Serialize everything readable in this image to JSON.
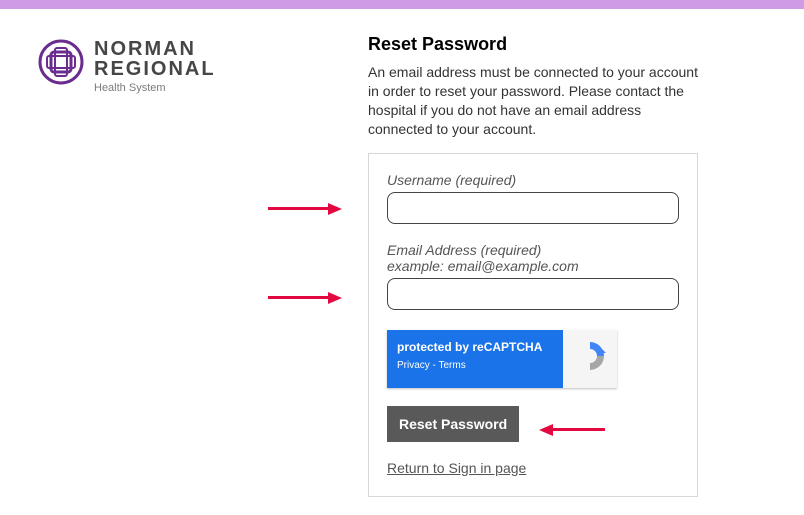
{
  "brand": {
    "name_line1": "NORMAN",
    "name_line2": "REGIONAL",
    "sub": "Health System"
  },
  "heading": "Reset Password",
  "description": "An email address must be connected to your account in order to reset your password. Please contact the hospital if you do not have an email address connected to your account.",
  "fields": {
    "username_label": "Username (required)",
    "email_label": "Email Address (required)",
    "email_example": "example: email@example.com"
  },
  "recaptcha": {
    "title": "protected by reCAPTCHA",
    "links": "Privacy - Terms"
  },
  "button": "Reset Password",
  "return_link": "Return to Sign in page"
}
